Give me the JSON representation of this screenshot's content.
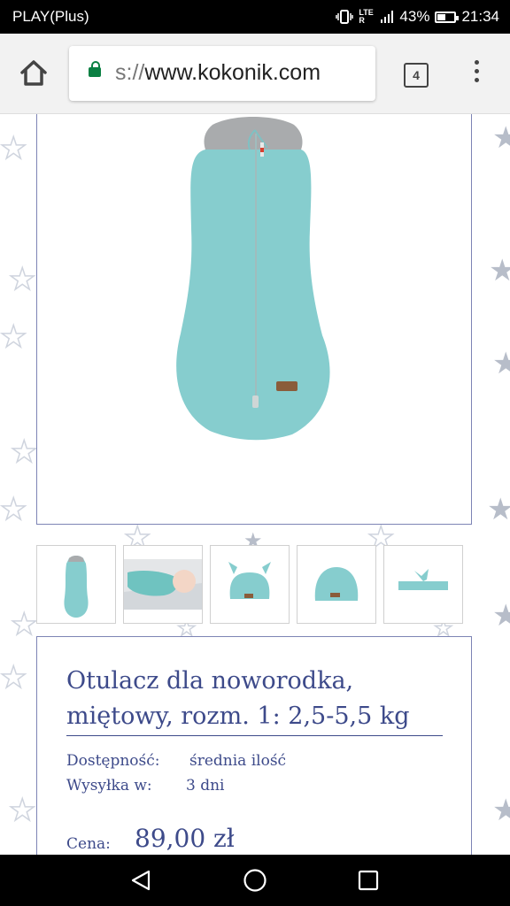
{
  "status": {
    "carrier": "PLAY(Plus)",
    "network": "LTE R",
    "battery": "43%",
    "battery_level": 0.43,
    "time": "21:34"
  },
  "browser": {
    "url_scheme": "s://",
    "url_host": "www.kokonik.com",
    "tab_count": "4"
  },
  "product": {
    "title_line1": "Otulacz dla noworodka,",
    "title_line2": "miętowy, rozm. 1: 2,5-5,5 kg",
    "availability_label": "Dostępność:",
    "availability_value": "średnia ilość",
    "shipping_label": "Wysyłka w:",
    "shipping_value": "3 dni",
    "price_label": "Cena:",
    "price_value": "89,00 zł"
  },
  "colors": {
    "mint": "#86cdce",
    "collar": "#a9abad",
    "accent_text": "#3d4a8a",
    "frame_border": "#7d84b5"
  },
  "thumbnails": [
    "swaddle-mint",
    "baby-in-swaddle",
    "knot-hat",
    "beanie",
    "headband"
  ]
}
